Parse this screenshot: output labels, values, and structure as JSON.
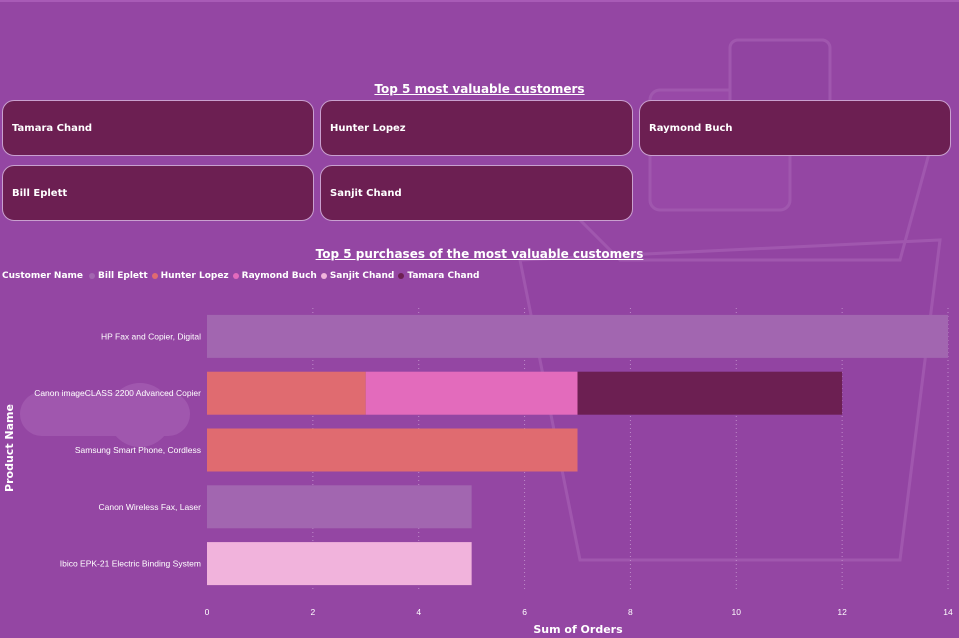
{
  "cards_title": "Top 5 most valuable customers",
  "cards": [
    "Tamara Chand",
    "Hunter Lopez",
    "Raymond Buch",
    "Bill Eplett",
    "Sanjit Chand"
  ],
  "chart_data": {
    "type": "bar",
    "orientation": "horizontal",
    "stacked": true,
    "title": "Top 5 purchases of the most valuable customers",
    "xlabel": "Sum of Orders",
    "ylabel": "Product Name",
    "xlim": [
      0,
      14
    ],
    "xticks": [
      0,
      2,
      4,
      6,
      8,
      10,
      12,
      14
    ],
    "grid": true,
    "legend_title": "Customer Name",
    "legend_position": "top-left",
    "categories": [
      "HP Fax and Copier, Digital",
      "Canon imageCLASS 2200 Advanced Copier",
      "Samsung Smart Phone, Cordless",
      "Canon Wireless Fax, Laser",
      "Ibico EPK-21 Electric Binding System"
    ],
    "series": [
      {
        "name": "Bill Eplett",
        "color": "#a266b0",
        "values": [
          14,
          0,
          0,
          5,
          0
        ]
      },
      {
        "name": "Hunter Lopez",
        "color": "#e06b70",
        "values": [
          0,
          3,
          7,
          0,
          0
        ]
      },
      {
        "name": "Raymond Buch",
        "color": "#e36bbc",
        "values": [
          0,
          4,
          0,
          0,
          0
        ]
      },
      {
        "name": "Sanjit Chand",
        "color": "#f1b3dc",
        "values": [
          0,
          0,
          0,
          0,
          5
        ]
      },
      {
        "name": "Tamara Chand",
        "color": "#6c1f52",
        "values": [
          0,
          5,
          0,
          0,
          0
        ]
      }
    ]
  }
}
